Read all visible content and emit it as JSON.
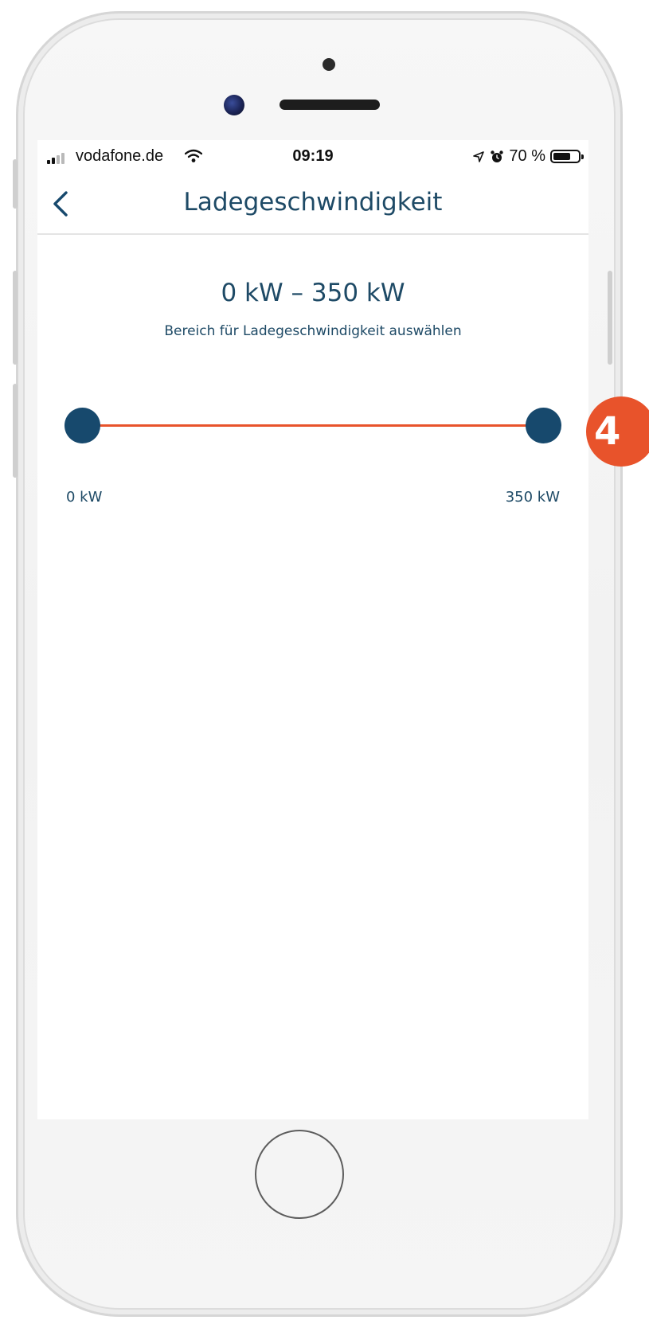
{
  "status_bar": {
    "carrier": "vodafone.de",
    "time": "09:19",
    "battery": "70 %",
    "battery_level": 0.7,
    "icons": [
      "signal-icon",
      "wifi-icon",
      "location-arrow-icon",
      "alarm-icon",
      "battery-icon"
    ]
  },
  "nav": {
    "title": "Ladegeschwindigkeit",
    "back_icon": "chevron-left-icon"
  },
  "range": {
    "value": "0 kW – 350 kW",
    "hint": "Bereich für Ladegeschwindigkeit auswählen",
    "min_label": "0 kW",
    "max_label": "350 kW",
    "min": 0,
    "max": 350,
    "selected_low": 0,
    "selected_high": 350
  },
  "badge": {
    "number": "4"
  },
  "colors": {
    "accent": "#e8532b",
    "primary": "#17496d",
    "text": "#1e4a66"
  }
}
